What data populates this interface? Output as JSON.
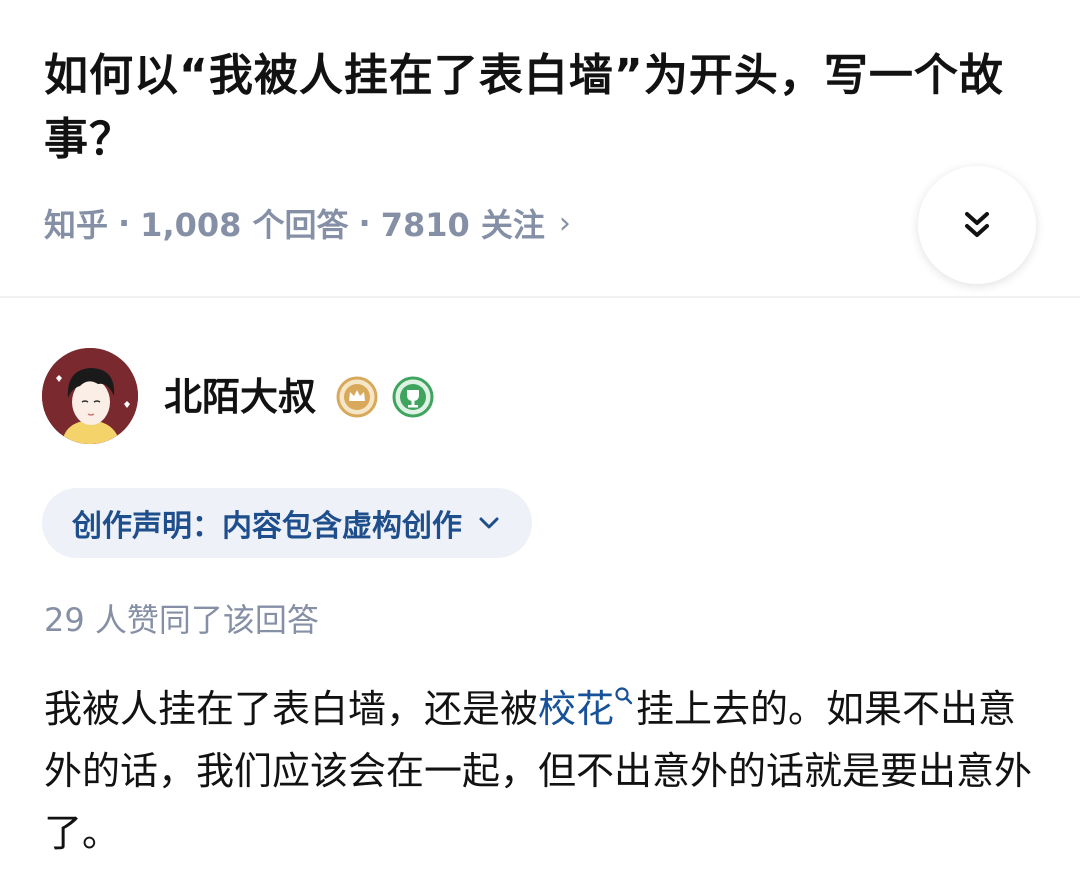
{
  "question": {
    "title": "如何以“我被人挂在了表白墙”为开头，写一个故事？",
    "source": "知乎",
    "separator": "·",
    "answers": "1,008 个回答",
    "followers": "7810 关注",
    "meta_chevron": "›"
  },
  "expand_button": {
    "icon": "double-chevron-down-icon"
  },
  "author": {
    "name": "北陌大叔",
    "badges": [
      "crown-badge-icon",
      "trophy-badge-icon"
    ]
  },
  "declaration": {
    "label": "创作声明：内容包含虚构创作",
    "icon": "chevron-down-icon"
  },
  "votes": "29 人赞同了该回答",
  "answer": {
    "before_link": "我被人挂在了表白墙，还是被",
    "link_text": "校花",
    "after_link": "挂上去的。如果不出意外的话，我们应该会在一起，但不出意外的话就是要出意外了。"
  },
  "colors": {
    "title": "#121212",
    "meta": "#8590a6",
    "link": "#175199",
    "declaration_bg": "#eef1f8",
    "declaration_text": "#1f4e8c"
  }
}
